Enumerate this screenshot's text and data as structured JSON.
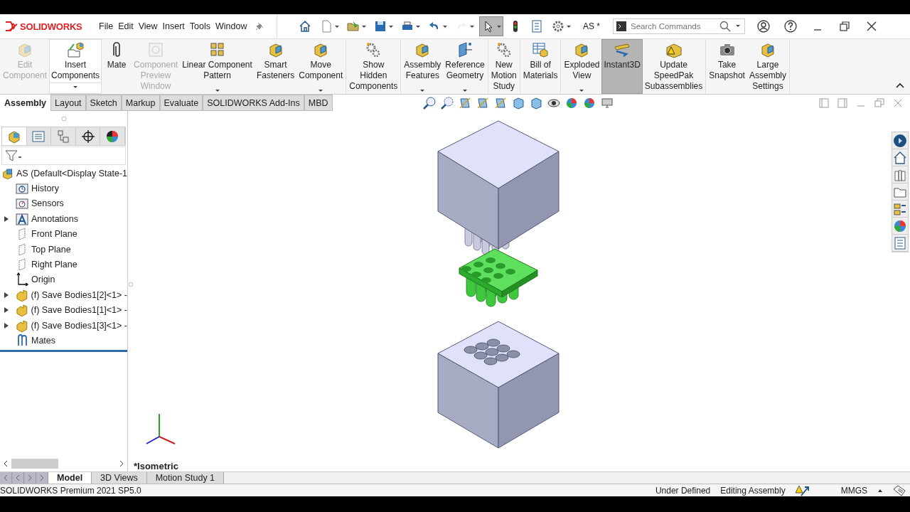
{
  "app": {
    "logo": "SOLIDWORKS",
    "menus": [
      "File",
      "Edit",
      "View",
      "Insert",
      "Tools",
      "Window"
    ],
    "document": "AS *",
    "search": {
      "placeholder": "Search Commands"
    }
  },
  "quick_access": [
    {
      "selected": false,
      "disabled": false
    },
    {
      "selected": false,
      "disabled": false
    },
    {
      "selected": false,
      "disabled": false
    },
    {
      "selected": false,
      "disabled": false
    },
    {
      "selected": false,
      "disabled": false
    },
    {
      "selected": false,
      "disabled": false
    },
    {
      "selected": false,
      "disabled": true
    },
    {
      "selected": true,
      "disabled": false
    },
    {
      "selected": false,
      "disabled": false
    },
    {
      "selected": false,
      "disabled": false
    },
    {
      "selected": false,
      "disabled": false
    }
  ],
  "ribbon": {
    "groups": [
      [
        {
          "label": "Edit\nComponent",
          "kind": "button",
          "disabled": true,
          "selected": false,
          "dropdown": false
        },
        {
          "label": "Insert\nComponents",
          "kind": "split",
          "disabled": false,
          "selected": false,
          "dropdown": true
        },
        {
          "label": "Mate",
          "kind": "button",
          "disabled": false,
          "selected": false,
          "dropdown": false
        },
        {
          "label": "Component\nPreview\nWindow",
          "kind": "button",
          "disabled": true,
          "selected": false,
          "dropdown": false
        },
        {
          "label": "Linear Component\nPattern",
          "kind": "button",
          "disabled": false,
          "selected": false,
          "dropdown": true
        },
        {
          "label": "Smart\nFasteners",
          "kind": "button",
          "disabled": false,
          "selected": false,
          "dropdown": false
        },
        {
          "label": "Move\nComponent",
          "kind": "button",
          "disabled": false,
          "selected": false,
          "dropdown": true
        }
      ],
      [
        {
          "label": "Show\nHidden\nComponents",
          "kind": "button",
          "disabled": false,
          "selected": false,
          "dropdown": false
        }
      ],
      [
        {
          "label": "Assembly\nFeatures",
          "kind": "button",
          "disabled": false,
          "selected": false,
          "dropdown": true
        },
        {
          "label": "Reference\nGeometry",
          "kind": "button",
          "disabled": false,
          "selected": false,
          "dropdown": true
        }
      ],
      [
        {
          "label": "New\nMotion\nStudy",
          "kind": "button",
          "disabled": false,
          "selected": false,
          "dropdown": false
        }
      ],
      [
        {
          "label": "Bill of\nMaterials",
          "kind": "button",
          "disabled": false,
          "selected": false,
          "dropdown": false
        }
      ],
      [
        {
          "label": "Exploded\nView",
          "kind": "button",
          "disabled": false,
          "selected": false,
          "dropdown": true
        },
        {
          "label": "Instant3D",
          "kind": "button",
          "disabled": false,
          "selected": true,
          "dropdown": false
        },
        {
          "label": "Update\nSpeedPak\nSubassemblies",
          "kind": "button",
          "disabled": false,
          "selected": false,
          "dropdown": false
        }
      ],
      [
        {
          "label": "Take\nSnapshot",
          "kind": "button",
          "disabled": false,
          "selected": false,
          "dropdown": false
        },
        {
          "label": "Large\nAssembly\nSettings",
          "kind": "button",
          "disabled": false,
          "selected": false,
          "dropdown": false
        }
      ]
    ]
  },
  "command_tabs": [
    {
      "label": "Assembly",
      "selected": true
    },
    {
      "label": "Layout",
      "selected": false
    },
    {
      "label": "Sketch",
      "selected": false
    },
    {
      "label": "Markup",
      "selected": false
    },
    {
      "label": "Evaluate",
      "selected": false
    },
    {
      "label": "SOLIDWORKS Add-Ins",
      "selected": false
    },
    {
      "label": "MBD",
      "selected": false
    }
  ],
  "panel_tabs": [
    {
      "selected": true
    },
    {
      "selected": false
    },
    {
      "selected": false
    },
    {
      "selected": false
    },
    {
      "selected": false
    }
  ],
  "feature_tree": {
    "root": "AS  (Default<Display State-1",
    "items": [
      {
        "label": "History",
        "kind": "history",
        "expandable": false
      },
      {
        "label": "Sensors",
        "kind": "sensors",
        "expandable": false
      },
      {
        "label": "Annotations",
        "kind": "annotations",
        "expandable": true
      },
      {
        "label": "Front Plane",
        "kind": "plane",
        "expandable": false
      },
      {
        "label": "Top Plane",
        "kind": "plane",
        "expandable": false
      },
      {
        "label": "Right Plane",
        "kind": "plane",
        "expandable": false
      },
      {
        "label": "Origin",
        "kind": "origin",
        "expandable": false
      },
      {
        "label": "(f) Save Bodies1[2]<1> -",
        "kind": "part",
        "expandable": true
      },
      {
        "label": "(f) Save Bodies1[1]<1> -",
        "kind": "part",
        "expandable": true
      },
      {
        "label": "(f) Save Bodies1[3]<1> -",
        "kind": "part",
        "expandable": true
      },
      {
        "label": "Mates",
        "kind": "mates",
        "expandable": false
      }
    ]
  },
  "viewport": {
    "view_name": "*Isometric"
  },
  "bottom_tabs": [
    {
      "label": "Model",
      "selected": true
    },
    {
      "label": "3D Views",
      "selected": false
    },
    {
      "label": "Motion Study 1",
      "selected": false
    }
  ],
  "status_bar": {
    "product": "SOLIDWORKS Premium 2021 SP5.0",
    "state": "Under Defined",
    "mode": "Editing Assembly",
    "units": "MMGS"
  }
}
